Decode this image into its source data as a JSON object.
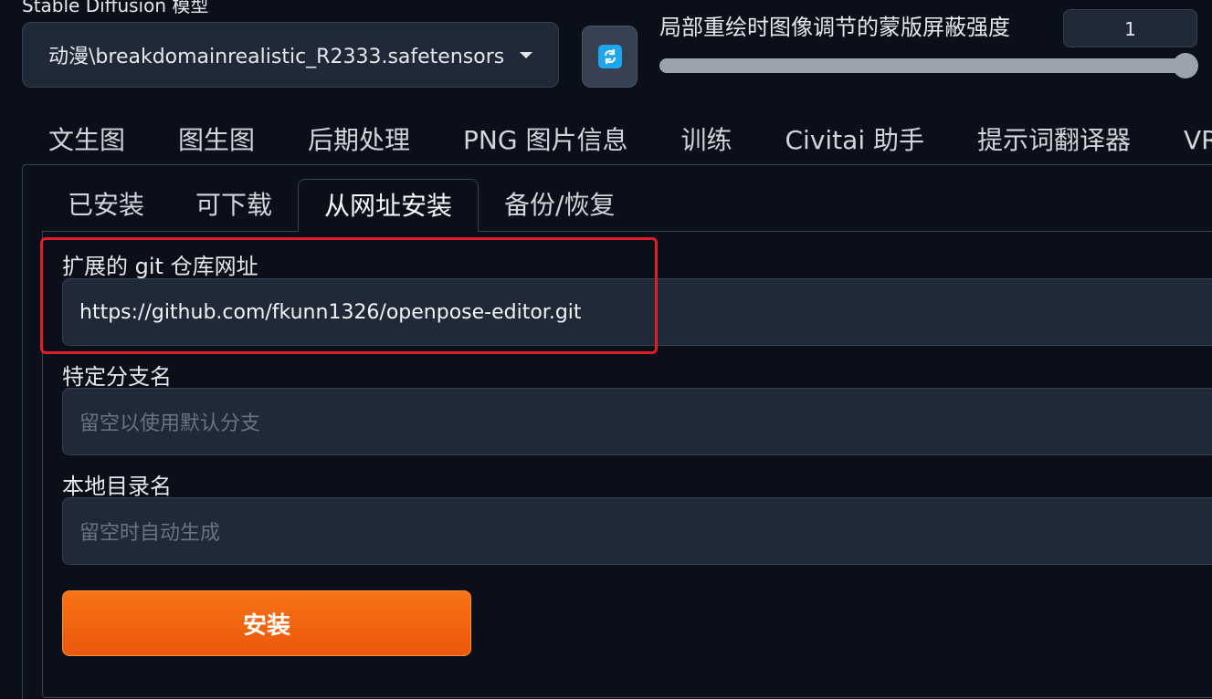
{
  "header": {
    "model_label": "Stable Diffusion 模型",
    "model_value": "动漫\\breakdomainrealistic_R2333.safetensors [",
    "colors": {
      "refresh_icon_bg": "#1ea7f0"
    }
  },
  "slider": {
    "label": "局部重绘时图像调节的蒙版屏蔽强度",
    "value": "1",
    "fraction": 1.0
  },
  "main_tabs": [
    {
      "label": "文生图"
    },
    {
      "label": "图生图"
    },
    {
      "label": "后期处理"
    },
    {
      "label": "PNG 图片信息"
    },
    {
      "label": "训练"
    },
    {
      "label": "Civitai 助手"
    },
    {
      "label": "提示词翻译器"
    },
    {
      "label": "VRAM"
    }
  ],
  "sub_tabs": [
    {
      "label": "已安装",
      "active": false
    },
    {
      "label": "可下载",
      "active": false
    },
    {
      "label": "从网址安装",
      "active": true
    },
    {
      "label": "备份/恢复",
      "active": false
    }
  ],
  "form": {
    "git_url": {
      "label": "扩展的 git 仓库网址",
      "value": "https://github.com/fkunn1326/openpose-editor.git"
    },
    "branch": {
      "label": "特定分支名",
      "placeholder": "留空以使用默认分支"
    },
    "local_dir": {
      "label": "本地目录名",
      "placeholder": "留空时自动生成"
    },
    "install_label": "安装"
  },
  "colors": {
    "accent": "#f97316",
    "highlight_border": "#e11d27"
  }
}
